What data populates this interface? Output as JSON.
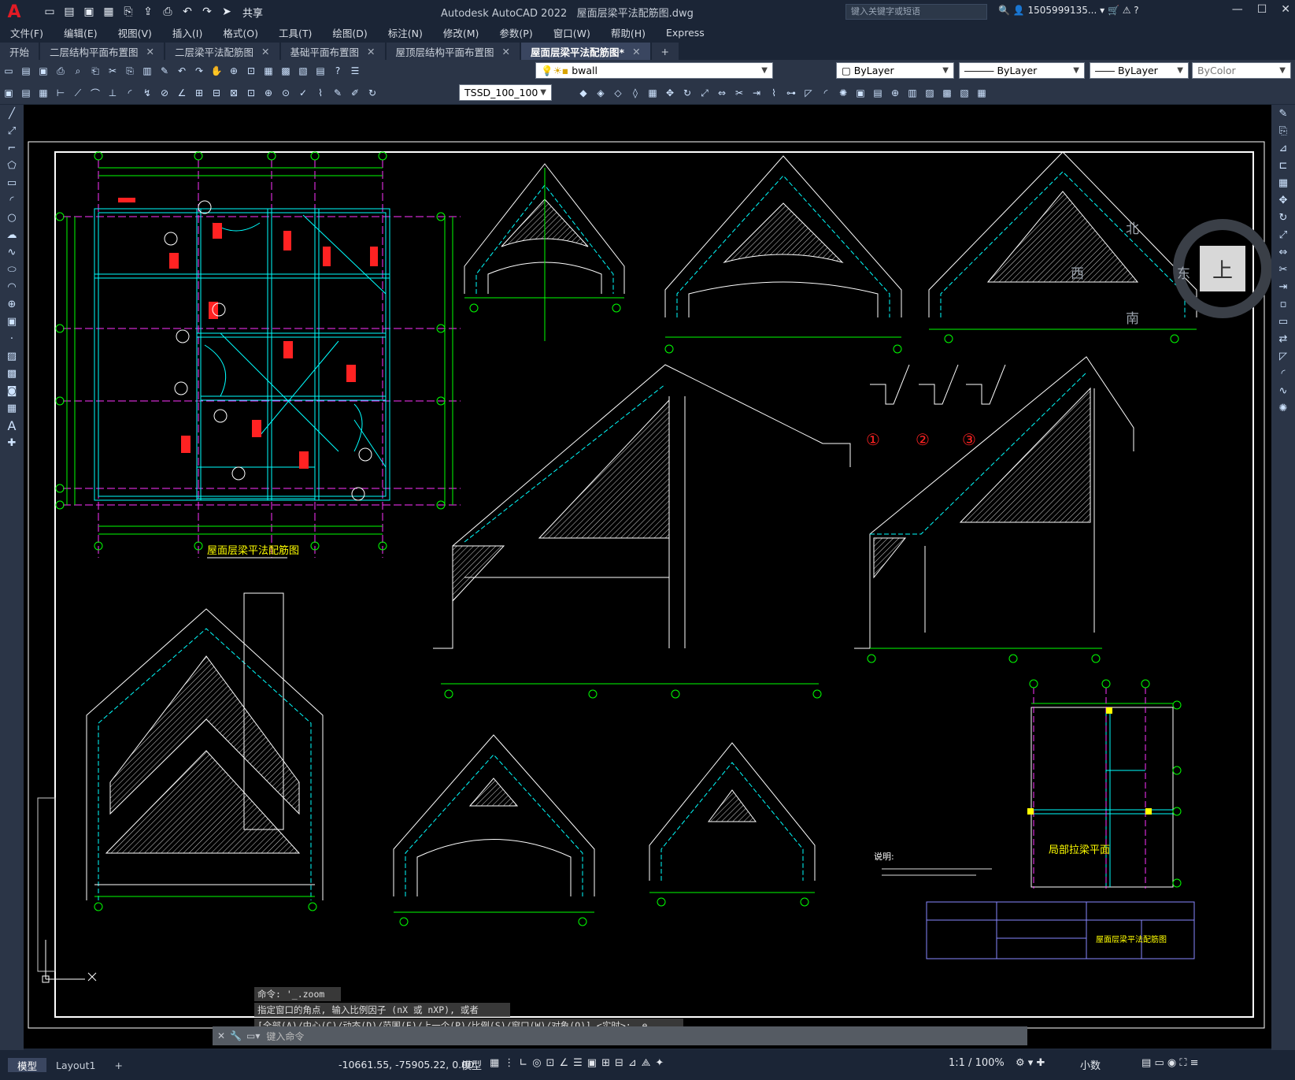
{
  "app": {
    "title": "Autodesk AutoCAD 2022",
    "file": "屋面层梁平法配筋图.dwg",
    "share": "共享",
    "search_placeholder": "键入关键字或短语",
    "user": "1505999135..."
  },
  "menus": [
    "文件(F)",
    "编辑(E)",
    "视图(V)",
    "插入(I)",
    "格式(O)",
    "工具(T)",
    "绘图(D)",
    "标注(N)",
    "修改(M)",
    "参数(P)",
    "窗口(W)",
    "帮助(H)",
    "Express"
  ],
  "tabs": [
    {
      "label": "开始"
    },
    {
      "label": "二层结构平面布置图"
    },
    {
      "label": "二层梁平法配筋图"
    },
    {
      "label": "基础平面布置图"
    },
    {
      "label": "屋顶层结构平面布置图"
    },
    {
      "label": "屋面层梁平法配筋图*",
      "active": true
    }
  ],
  "layer": "bwall",
  "props": {
    "color": "ByLayer",
    "linetype": "ByLayer",
    "lineweight": "ByLayer",
    "plotstyle": "ByColor"
  },
  "dimstyle": "TSSD_100_100",
  "viewcube": {
    "top": "上",
    "north": "北",
    "south": "南",
    "east": "东",
    "west": "西"
  },
  "drawing": {
    "plan_title": "屋面层梁平法配筋图",
    "local_plan_title": "局部拉梁平面",
    "notes_title": "说明:",
    "sheet_title": "屋面层梁平法配筋图",
    "section_markers": [
      "①",
      "②",
      "③"
    ],
    "grid_labels": [
      "1",
      "2",
      "3",
      "4",
      "5",
      "6",
      "A",
      "B",
      "C",
      "D",
      "E",
      "F"
    ]
  },
  "command": {
    "line1": "命令: '_.zoom",
    "line2": "指定窗口的角点, 输入比例因子 (nX 或 nXP), 或者",
    "line3": "[全部(A)/中心(C)/动态(D)/范围(E)/上一个(P)/比例(S)/窗口(W)/对象(O)] <实时>: _e",
    "placeholder": "键入命令"
  },
  "layouts": [
    "模型",
    "Layout1"
  ],
  "status": {
    "coords": "-10661.55, -75905.22, 0.00",
    "space": "模型",
    "scale": "1:1 / 100%",
    "units": "小数"
  }
}
